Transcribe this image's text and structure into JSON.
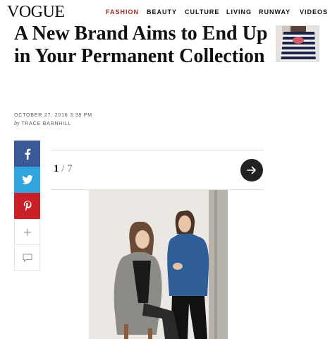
{
  "header": {
    "logo": "VOGUE",
    "nav": [
      "FASHION",
      "BEAUTY",
      "CULTURE",
      "LIVING",
      "RUNWAY",
      "VIDEOS"
    ],
    "active_nav": "FASHION",
    "accent_color": "#9b2a24"
  },
  "article": {
    "title": "A New Brand Aims to End Up in Your Permanent Collection",
    "date": "OCTOBER 27, 2016 3:38 PM",
    "by_word": "by",
    "author": "TRACE BARNHILL"
  },
  "share": {
    "icons": [
      "facebook-icon",
      "twitter-icon",
      "pinterest-icon",
      "plus-icon",
      "comment-icon"
    ],
    "colors": {
      "facebook": "#3b5998",
      "twitter": "#31a3dd",
      "pinterest": "#cb2027"
    }
  },
  "gallery": {
    "current": "1",
    "separator": "/",
    "total": "7",
    "next_icon": "arrow-right-icon"
  }
}
